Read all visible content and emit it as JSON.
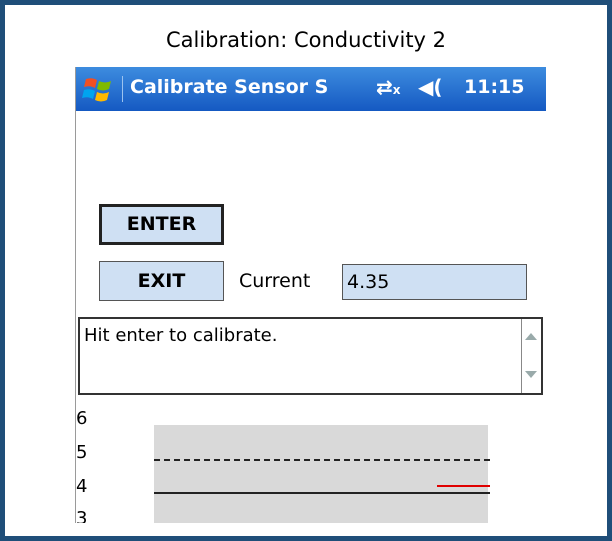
{
  "caption": "Calibration: Conductivity 2",
  "titlebar": {
    "title": "Calibrate Sensor S",
    "time": "11:15",
    "icons": [
      "windows-start-icon",
      "connectivity-icon",
      "volume-icon"
    ]
  },
  "buttons": {
    "enter": "ENTER",
    "exit": "EXIT"
  },
  "current": {
    "label": "Current",
    "value": "4.35"
  },
  "message": "Hit enter to calibrate.",
  "chart_data": {
    "type": "line",
    "y_ticks": [
      "6",
      "5",
      "4",
      "3"
    ],
    "reference_dashed": 5,
    "reference_solid": 4,
    "current_reading_color": "#e00000"
  },
  "colors": {
    "frame": "#1f4e79",
    "titlebar": "#2a6fd1",
    "field": "#cfe0f3"
  }
}
